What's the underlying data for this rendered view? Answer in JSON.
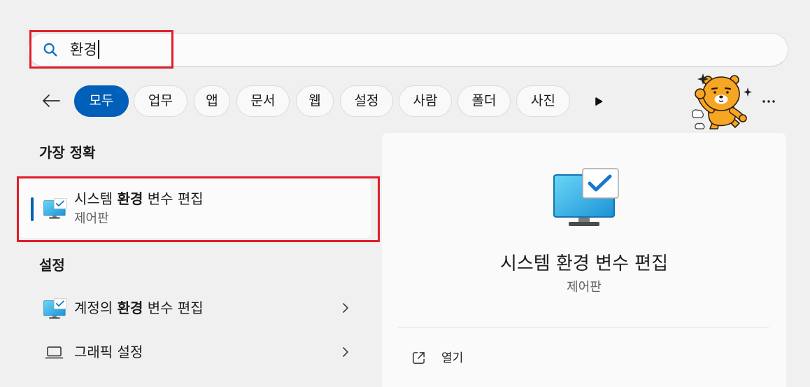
{
  "search": {
    "icon": "search-icon",
    "query": "환경"
  },
  "filters": {
    "back_icon": "back-arrow-icon",
    "items": [
      {
        "label": "모두",
        "selected": true
      },
      {
        "label": "업무",
        "selected": false
      },
      {
        "label": "앱",
        "selected": false
      },
      {
        "label": "문서",
        "selected": false
      },
      {
        "label": "웹",
        "selected": false
      },
      {
        "label": "설정",
        "selected": false
      },
      {
        "label": "사람",
        "selected": false
      },
      {
        "label": "폴더",
        "selected": false
      },
      {
        "label": "사진",
        "selected": false
      }
    ],
    "scroll_icon": "play-right-icon",
    "highlight_image": "ryan-character-icon",
    "more_icon": "more-dots-icon"
  },
  "best_match": {
    "header": "가장 정확",
    "item": {
      "icon": "monitor-check-icon",
      "title_before": "시스템 ",
      "title_match": "환경",
      "title_after": " 변수 편집",
      "subtitle": "제어판"
    }
  },
  "settings": {
    "header": "설정",
    "items": [
      {
        "icon": "monitor-check-icon",
        "title_before": "계정의 ",
        "title_match": "환경",
        "title_after": " 변수 편집",
        "chevron_icon": "chevron-right-icon"
      },
      {
        "icon": "laptop-icon",
        "title": "그래픽 설정",
        "chevron_icon": "chevron-right-icon"
      }
    ]
  },
  "preview": {
    "icon": "monitor-check-icon",
    "title": "시스템 환경 변수 편집",
    "subtitle": "제어판",
    "actions": [
      {
        "icon": "open-external-icon",
        "label": "열기"
      }
    ]
  },
  "colors": {
    "accent": "#005fb8",
    "annotation": "#e11d2a",
    "background": "#f0f0f0",
    "panel": "#fafafa"
  }
}
